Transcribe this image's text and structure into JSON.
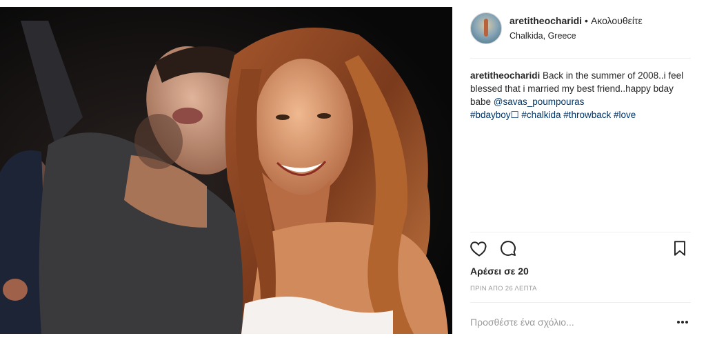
{
  "post": {
    "username": "aretitheocharidi",
    "separator": "•",
    "follow_label": "Ακολουθείτε",
    "location": "Chalkida, Greece"
  },
  "caption": {
    "username": "aretitheocharidi",
    "text": " Back in the summer of 2008..i feel blessed that i married my best friend..happy bday babe ",
    "mention": "@savas_poumpouras",
    "tags": [
      "#bdayboy☐",
      "#chalkida",
      "#throwback",
      "#love"
    ]
  },
  "stats": {
    "likes": "Αρέσει σε 20",
    "timestamp": "ΠΡΙΝ ΑΠΟ 26 ΛΕΠΤΑ"
  },
  "comment": {
    "placeholder": "Προσθέστε ένα σχόλιο..."
  },
  "icons": {
    "like": "heart-icon",
    "comment": "comment-icon",
    "save": "bookmark-icon",
    "more": "more-options-icon"
  },
  "colors": {
    "link": "#003569",
    "muted": "#999999",
    "text": "#262626"
  }
}
